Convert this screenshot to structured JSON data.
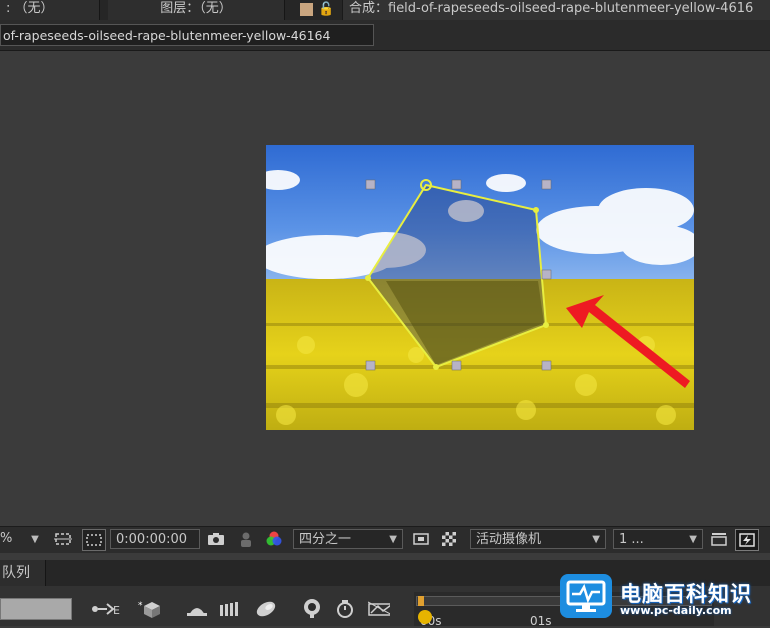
{
  "header": {
    "tab_effects": ": （无）",
    "tab_layer": "图层：（无）",
    "tab_comp": "合成：field-of-rapeseeds-oilseed-rape-blutenmeer-yellow-4616",
    "comp_label_color": "#c9a57f",
    "lock_icon": "lock-icon"
  },
  "comp_tab": {
    "label": "of-rapeseeds-oilseed-rape-blutenmeer-yellow-46164"
  },
  "viewer_toolbar": {
    "zoom_label": "%",
    "timecode": "0:00:00:00",
    "resolution": "四分之一",
    "camera": "活动摄像机",
    "views": "1 ..."
  },
  "panel": {
    "tab_label": "队列"
  },
  "timeline": {
    "ruler_start": "00s",
    "ruler_01s": "01s",
    "playhead_color": "#e0a030"
  },
  "watermark": {
    "title": "电脑百科知识",
    "url": "www.pc-daily.com",
    "badge_color": "#1d8de0"
  },
  "mask": {
    "stroke_color": "#e8ee40",
    "arrow_color": "#ee1a22"
  }
}
